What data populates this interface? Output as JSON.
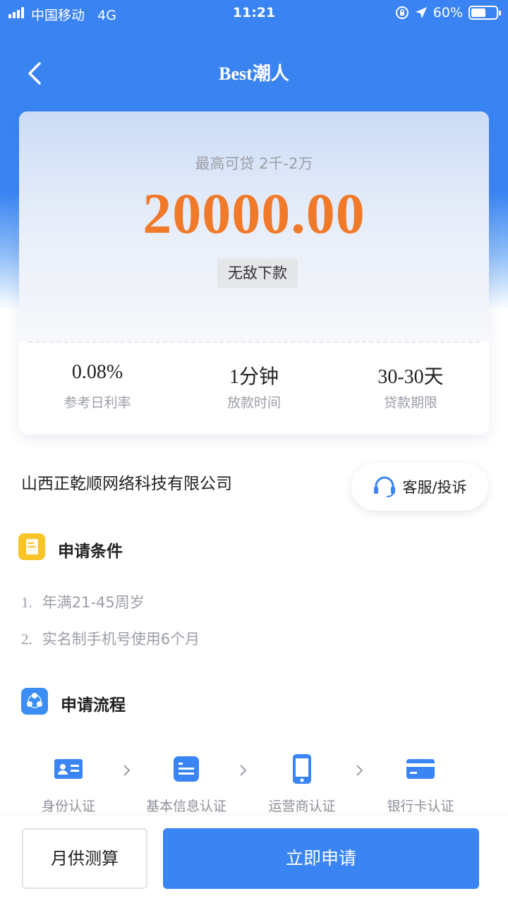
{
  "status_bar": {
    "carrier": "中国移动",
    "network": "4G",
    "time": "11:21",
    "battery": "60%",
    "battery_level": 0.6
  },
  "nav": {
    "title": "Best潮人"
  },
  "loan_card": {
    "range_text": "最高可贷 2千-2万",
    "amount": "20000.00",
    "tag": "无敌下款",
    "stats": [
      {
        "value": "0.08%",
        "label": "参考日利率"
      },
      {
        "value": "1分钟",
        "label": "放款时间"
      },
      {
        "value": "30-30天",
        "label": "贷款期限"
      }
    ]
  },
  "company": {
    "name": "山西正乾顺网络科技有限公司",
    "service_label": "客服/投诉"
  },
  "conditions": {
    "title": "申请条件",
    "items": [
      {
        "num": "1.",
        "text": "年满21-45周岁"
      },
      {
        "num": "2.",
        "text": "实名制手机号使用6个月"
      }
    ]
  },
  "process": {
    "title": "申请流程",
    "steps": [
      {
        "label": "身份认证",
        "icon": "id-card-icon"
      },
      {
        "label": "基本信息认证",
        "icon": "info-list-icon"
      },
      {
        "label": "运营商认证",
        "icon": "phone-icon"
      },
      {
        "label": "银行卡认证",
        "icon": "bank-card-icon"
      }
    ]
  },
  "actions": {
    "calc_label": "月供测算",
    "apply_label": "立即申请"
  },
  "colors": {
    "primary": "#3a85f3",
    "amount": "#f07a2a",
    "conditions_icon": "#f8c428"
  }
}
